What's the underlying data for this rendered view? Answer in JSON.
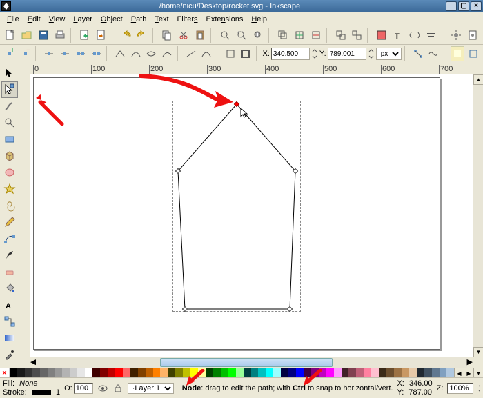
{
  "window": {
    "title": "/home/nicu/Desktop/rocket.svg - Inkscape"
  },
  "menu": [
    "File",
    "Edit",
    "View",
    "Layer",
    "Object",
    "Path",
    "Text",
    "Filters",
    "Extensions",
    "Help"
  ],
  "toolbar_coords": {
    "x_label": "X:",
    "x_value": "340.500",
    "y_label": "Y:",
    "y_value": "789.001",
    "unit": "px"
  },
  "ruler_h_ticks": [
    "0",
    "100",
    "200",
    "300",
    "400",
    "500",
    "600",
    "700"
  ],
  "status": {
    "fill_label": "Fill:",
    "fill_value": "None",
    "stroke_label": "Stroke:",
    "opacity_label": "O:",
    "opacity_value": "100",
    "stroke_width_suffix": "1",
    "layer_label": "Layer 1",
    "hint_prefix": "Node",
    "hint_mid": ": drag to edit the path; with ",
    "hint_bold": "Ctrl",
    "hint_suffix": " to snap to horizontal/vert.",
    "cursor_x_label": "X:",
    "cursor_x": "346.00",
    "cursor_y_label": "Y:",
    "cursor_y": "787.00",
    "zoom_label": "Z:",
    "zoom_value": "100%"
  },
  "palette_colors": [
    "#000000",
    "#1a1a1a",
    "#333333",
    "#4d4d4d",
    "#666666",
    "#808080",
    "#999999",
    "#b3b3b3",
    "#cccccc",
    "#e6e6e6",
    "#ffffff",
    "#400000",
    "#800000",
    "#c00000",
    "#ff0000",
    "#ff6666",
    "#402000",
    "#804000",
    "#c06000",
    "#ff8000",
    "#ffb366",
    "#404000",
    "#808000",
    "#c0c000",
    "#ffff00",
    "#ffff99",
    "#004000",
    "#008000",
    "#00c000",
    "#00ff00",
    "#99ff99",
    "#004040",
    "#008080",
    "#00c0c0",
    "#00ffff",
    "#99ffff",
    "#000040",
    "#000080",
    "#0000ff",
    "#400040",
    "#800080",
    "#c000c0",
    "#ff00ff",
    "#ff99ff",
    "#402028",
    "#804050",
    "#c06078",
    "#ff80a0",
    "#ffc0d0",
    "#3a2a18",
    "#6b4e2e",
    "#9c7244",
    "#c99863",
    "#e6c9a8",
    "#202830",
    "#405060",
    "#607890",
    "#80a0c0",
    "#b0c8e0"
  ]
}
